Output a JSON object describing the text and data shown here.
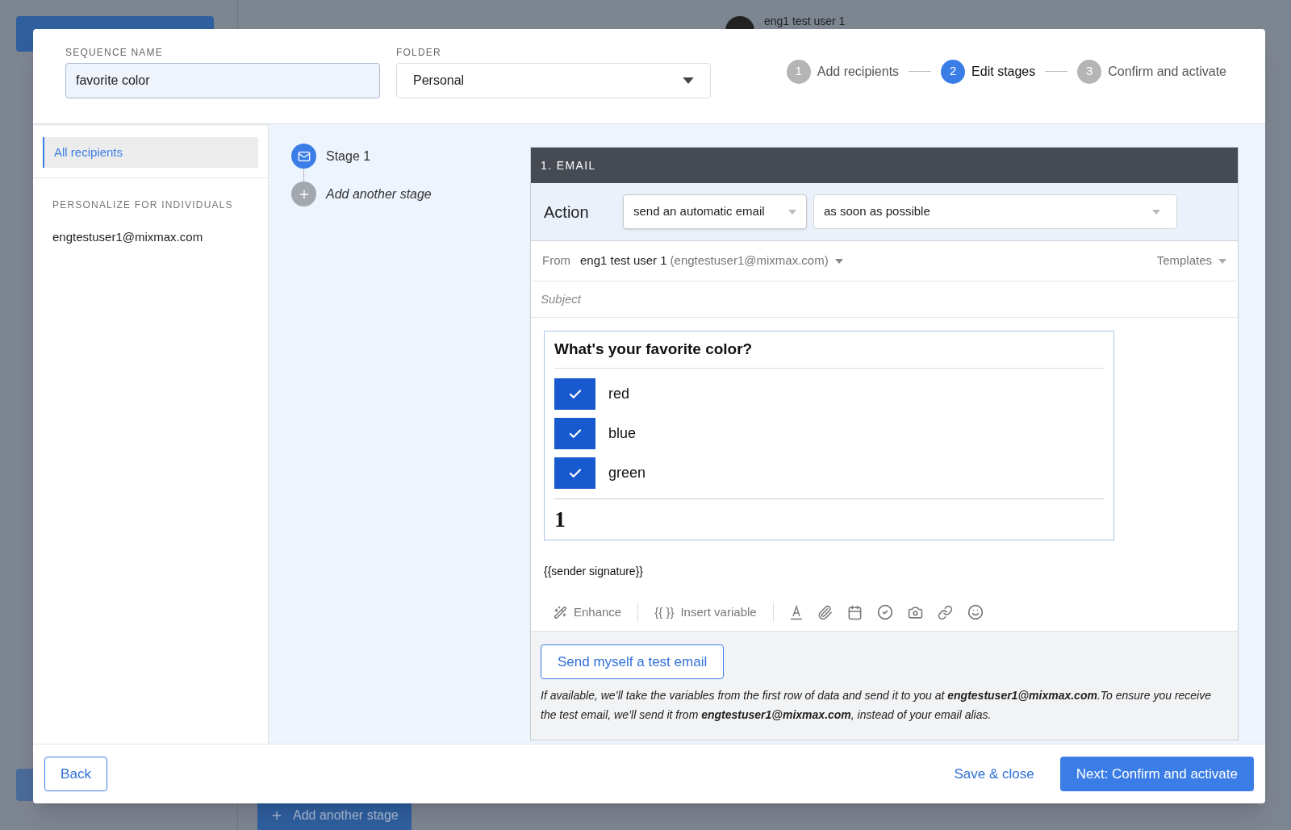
{
  "background": {
    "user": "eng1 test user 1",
    "add_stage_button": "Add another stage"
  },
  "header": {
    "name_label": "SEQUENCE NAME",
    "name_value": "favorite color",
    "folder_label": "FOLDER",
    "folder_value": "Personal",
    "steps": [
      {
        "number": "1",
        "label": "Add recipients",
        "selected": false
      },
      {
        "number": "2",
        "label": "Edit stages",
        "selected": true
      },
      {
        "number": "3",
        "label": "Confirm and activate",
        "selected": false
      }
    ]
  },
  "sidebar": {
    "items": [
      {
        "label": "All recipients",
        "selected": true
      }
    ],
    "section_title": "PERSONALIZE FOR INDIVIDUALS",
    "individuals": [
      {
        "label": "engtestuser1@mixmax.com",
        "selected": false
      }
    ]
  },
  "stages": [
    {
      "label": "Stage 1",
      "kind": "email"
    },
    {
      "label": "Add another stage",
      "kind": "add"
    }
  ],
  "email": {
    "title": "1. EMAIL",
    "action_label": "Action",
    "action_value": "send an automatic email",
    "timing_value": "as soon as possible",
    "from_label": "From",
    "from_name": "eng1 test user 1",
    "from_address": "(engtestuser1@mixmax.com)",
    "templates": "Templates",
    "subject_placeholder": "Subject",
    "poll": {
      "question": "What's your favorite color?",
      "options": [
        {
          "label": "red",
          "checked": true
        },
        {
          "label": "blue",
          "checked": true
        },
        {
          "label": "green",
          "checked": true
        }
      ],
      "footer": "1"
    },
    "signature": "{{sender signature}}",
    "toolbar": {
      "enhance": "Enhance",
      "variable_glyph": "{{ }}",
      "insert_variable": "Insert variable"
    },
    "test_button": "Send myself a test email",
    "test_note": "If available, we’ll take the variables from the first row of data and send it to you at **engtestuser1@mixmax.com**.To ensure you receive the test email, we’ll send it from **engtestuser1@mixmax.com**, instead of your email alias."
  },
  "footer": {
    "back": "Back",
    "save": "Save & close",
    "next": "Next: Confirm and activate"
  }
}
